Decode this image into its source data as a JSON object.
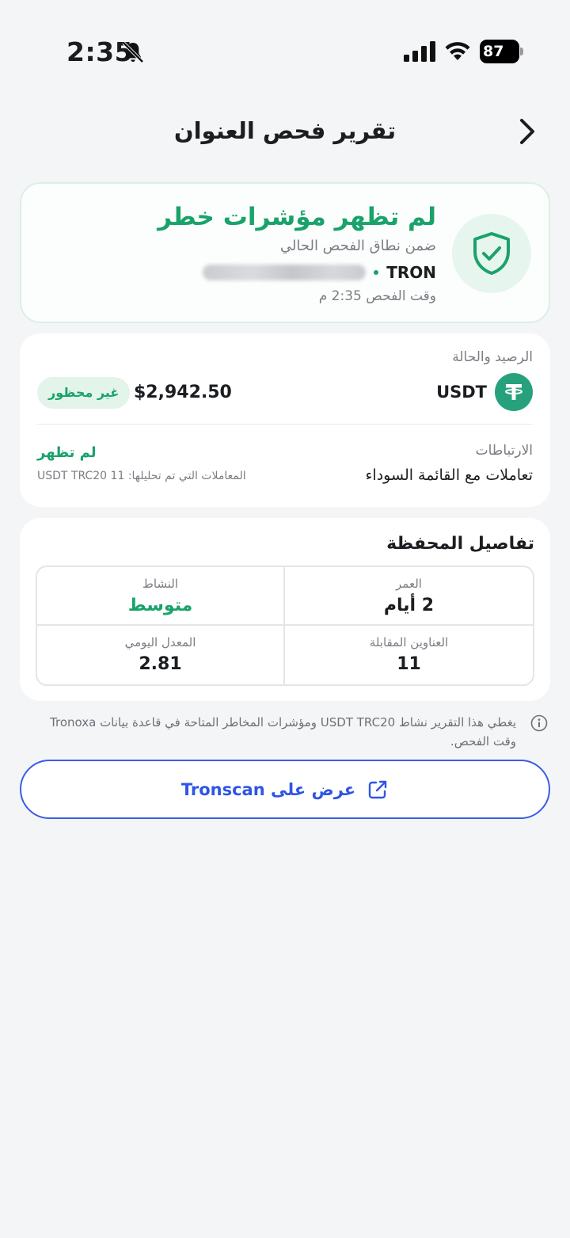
{
  "status_bar": {
    "time": "2:35",
    "battery": "87"
  },
  "header": {
    "title": "تقرير فحص العنوان"
  },
  "result": {
    "title": "لم تظهر مؤشرات خطر",
    "subtitle": "ضمن نطاق الفحص الحالي",
    "network": "TRON",
    "scan_time": "وقت الفحص 2:35 م",
    "icon": "shield-check-icon"
  },
  "balance": {
    "label": "الرصيد والحالة",
    "token": "USDT",
    "amount": "$2,942.50",
    "status": "غير محظور",
    "associations_label": "الارتباطات",
    "associations_value": "تعاملات مع القائمة السوداء",
    "associations_status": "لم تظهر",
    "associations_note": "المعاملات التي تم تحليلها: 11 USDT TRC20"
  },
  "details": {
    "title": "تفاصيل المحفظة",
    "age_label": "العمر",
    "age_value": "2 أيام",
    "activity_label": "النشاط",
    "activity_value": "متوسط",
    "counterparties_label": "العناوين المقابلة",
    "counterparties_value": "11",
    "daily_rate_label": "المعدل اليومي",
    "daily_rate_value": "2.81"
  },
  "info_note": "يغطي هذا التقرير نشاط USDT TRC20 ومؤشرات المخاطر المتاحة في قاعدة بيانات Tronoxa وقت الفحص.",
  "tronscan_button": {
    "label": "عرض على Tronscan",
    "icon": "external-link-icon"
  },
  "colors": {
    "accent_green": "#1aa26b",
    "accent_blue": "#2f55e4",
    "tether_green": "#26a17b"
  }
}
